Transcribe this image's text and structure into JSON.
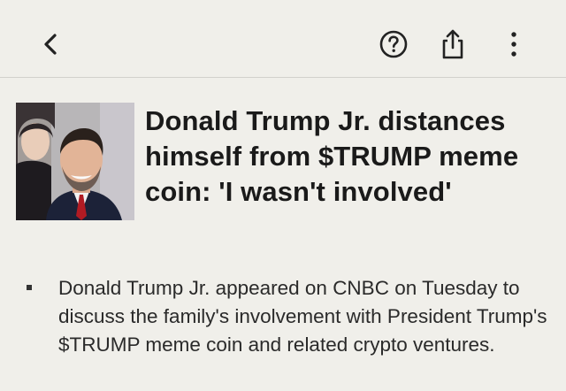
{
  "toolbar": {
    "back_icon": "chevron-left-icon",
    "help_icon": "question-circle-icon",
    "share_icon": "share-icon",
    "more_icon": "more-vertical-icon"
  },
  "article": {
    "headline": "Donald Trump Jr. distances himself from $TRUMP meme coin: 'I wasn't involved'",
    "thumbnail": "article-thumbnail",
    "summary": [
      "Donald Trump Jr. appeared on CNBC on Tuesday to discuss the family's involvement with President Trump's $TRUMP meme coin and related crypto ventures."
    ]
  },
  "colors": {
    "background": "#f0efea",
    "divider": "#d2d1cc",
    "text": "#1a1a1a"
  }
}
